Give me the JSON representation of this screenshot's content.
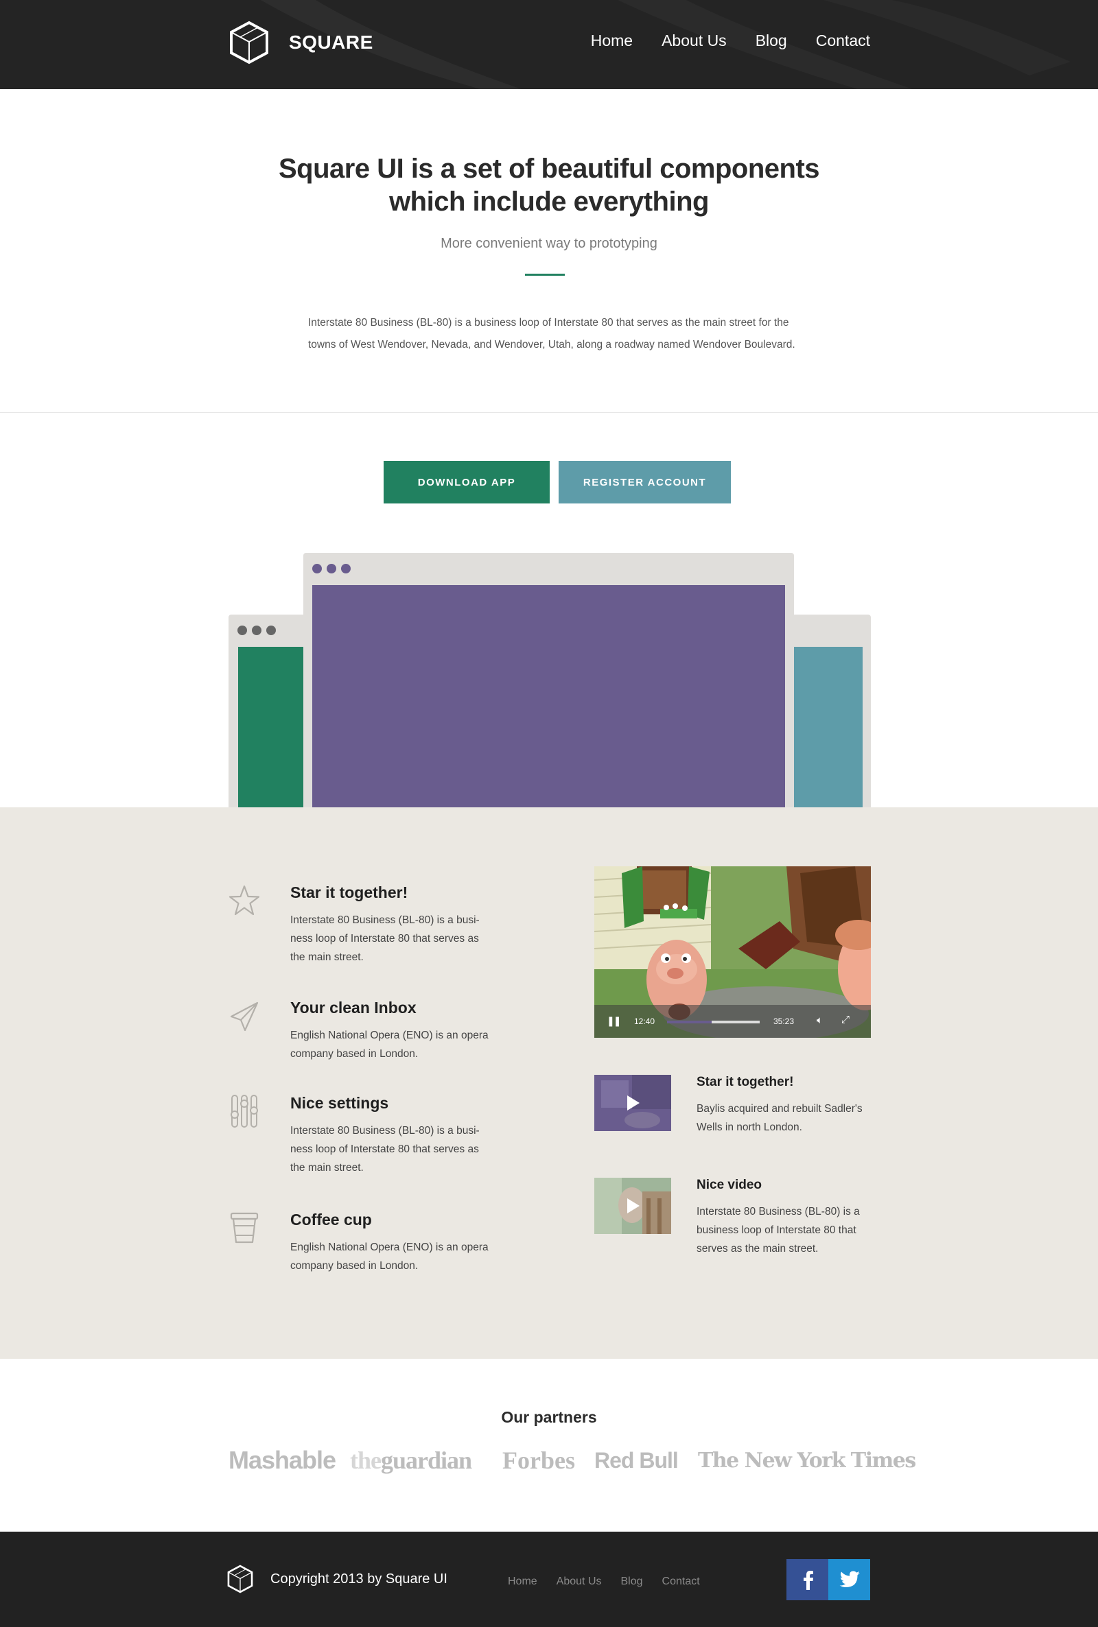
{
  "header": {
    "brand": "SQUARE",
    "nav": [
      "Home",
      "About Us",
      "Blog",
      "Contact"
    ]
  },
  "hero": {
    "title_line1": "Square UI is a set of beautiful components",
    "title_line2": "which include everything",
    "subtitle": "More convenient way to prototyping",
    "body": "Interstate 80 Business (BL-80) is a business loop of Interstate 80 that serves as the main street for the towns of West Wendover, Nevada, and Wendover, Utah, along a roadway named Wendover Boulevard."
  },
  "cta": {
    "download": "DOWNLOAD APP",
    "register": "REGISTER ACCOUNT"
  },
  "colors": {
    "green": "#218160",
    "blue": "#5e9ca9",
    "purple": "#695c8e",
    "header_bg": "#242424",
    "features_bg": "#ebe8e2",
    "facebook": "#355195",
    "twitter": "#1f8fd1"
  },
  "features": [
    {
      "icon": "star-icon",
      "title": "Star it together!",
      "text": "Interstate 80 Business (BL-80) is a busi-ness loop of Interstate 80 that serves as the main street."
    },
    {
      "icon": "paper-plane-icon",
      "title": "Your clean Inbox",
      "text": "English National Opera (ENO) is an opera company based in London."
    },
    {
      "icon": "sliders-icon",
      "title": "Nice settings",
      "text": "Interstate 80 Business (BL-80) is a busi-ness loop of Interstate 80 that serves as the main street."
    },
    {
      "icon": "coffee-cup-icon",
      "title": "Coffee cup",
      "text": "English National Opera (ENO) is an opera company based in London."
    }
  ],
  "video": {
    "current_time": "12:40",
    "duration": "35:23",
    "progress": 0.48
  },
  "mini_videos": [
    {
      "title": "Star it together!",
      "text": "Baylis acquired and rebuilt Sadler's Wells in north London."
    },
    {
      "title": "Nice video",
      "text": "Interstate 80 Business (BL-80) is a business loop of Interstate 80 that serves as the main street."
    }
  ],
  "partners": {
    "title": "Our partners",
    "logos": {
      "mashable": "Mashable",
      "guardian_the": "the",
      "guardian_rest": "guardian",
      "forbes": "Forbes",
      "redbull": "Red Bull",
      "nyt": "The New York Times"
    }
  },
  "footer": {
    "copyright": "Copyright 2013 by Square UI",
    "nav": [
      "Home",
      "About Us",
      "Blog",
      "Contact"
    ]
  }
}
